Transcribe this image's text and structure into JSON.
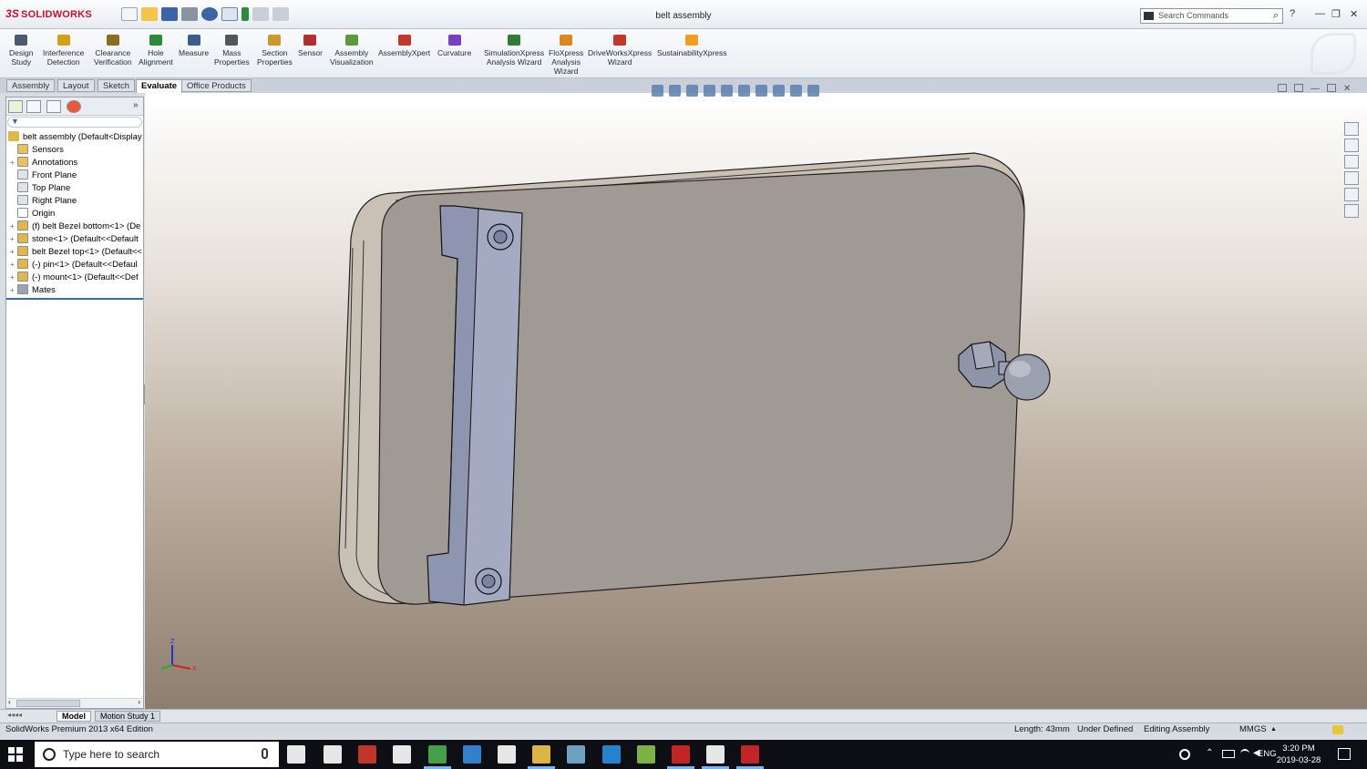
{
  "titlebar": {
    "brand_ds": "3S",
    "brand_name": "SOLIDWORKS",
    "document_title": "belt assembly",
    "search_placeholder": "Search Commands",
    "help_icon": "?",
    "minimize": "—",
    "restore": "❐",
    "close": "✕"
  },
  "ribbon": {
    "buttons": [
      {
        "label": "Design\nStudy",
        "icon": "design-study-icon",
        "color": "#4a5a70"
      },
      {
        "label": "Interference\nDetection",
        "icon": "interference-icon",
        "color": "#d4a017"
      },
      {
        "label": "Clearance\nVerification",
        "icon": "clearance-icon",
        "color": "#8a6d1e"
      },
      {
        "label": "Hole\nAlignment",
        "icon": "hole-alignment-icon",
        "color": "#2d8a3a"
      },
      {
        "label": "Measure",
        "icon": "measure-icon",
        "color": "#3a5d8c"
      },
      {
        "label": "Mass\nProperties",
        "icon": "mass-properties-icon",
        "color": "#555"
      },
      {
        "label": "Section\nProperties",
        "icon": "section-properties-icon",
        "color": "#c99a2e"
      },
      {
        "label": "Sensor",
        "icon": "sensor-icon",
        "color": "#b03030"
      },
      {
        "label": "Assembly\nVisualization",
        "icon": "assembly-visualization-icon",
        "color": "#5a9a3a"
      },
      {
        "label": "AssemblyXpert",
        "icon": "assemblyxpert-icon",
        "color": "#c0392b"
      },
      {
        "label": "Curvature",
        "icon": "curvature-icon",
        "color": "#7a3fc0"
      },
      {
        "label": "SimulationXpress\nAnalysis Wizard",
        "icon": "simulationxpress-icon",
        "color": "#2e7d32"
      },
      {
        "label": "FloXpress\nAnalysis\nWizard",
        "icon": "floxpress-icon",
        "color": "#d98a1e"
      },
      {
        "label": "DriveWorksXpress\nWizard",
        "icon": "driveworksxpress-icon",
        "color": "#c0392b"
      },
      {
        "label": "SustainabilityXpress",
        "icon": "sustainabilityxpress-icon",
        "color": "#f0a020"
      }
    ]
  },
  "tabs": [
    {
      "label": "Assembly",
      "active": false
    },
    {
      "label": "Layout",
      "active": false
    },
    {
      "label": "Sketch",
      "active": false
    },
    {
      "label": "Evaluate",
      "active": true
    },
    {
      "label": "Office Products",
      "active": false
    }
  ],
  "tree": {
    "root": "belt assembly  (Default<Display",
    "items": [
      {
        "label": "Sensors",
        "expander": "",
        "icon": "sensors-folder-icon",
        "color": "#e8c15a"
      },
      {
        "label": "Annotations",
        "expander": "+",
        "icon": "annotations-icon",
        "color": "#e8c15a"
      },
      {
        "label": "Front Plane",
        "expander": "",
        "icon": "plane-icon",
        "color": "#dfe3e8"
      },
      {
        "label": "Top Plane",
        "expander": "",
        "icon": "plane-icon",
        "color": "#dfe3e8"
      },
      {
        "label": "Right Plane",
        "expander": "",
        "icon": "plane-icon",
        "color": "#dfe3e8"
      },
      {
        "label": "Origin",
        "expander": "",
        "icon": "origin-icon",
        "color": "#ffffff"
      },
      {
        "label": "(f) belt Bezel bottom<1> (De",
        "expander": "+",
        "icon": "part-icon",
        "color": "#e0b84a"
      },
      {
        "label": "stone<1> (Default<<Default",
        "expander": "+",
        "icon": "part-icon",
        "color": "#e0b84a"
      },
      {
        "label": "belt Bezel top<1> (Default<<",
        "expander": "+",
        "icon": "part-icon",
        "color": "#e0b84a"
      },
      {
        "label": "(-) pin<1> (Default<<Defaul",
        "expander": "+",
        "icon": "part-icon",
        "color": "#e0b84a"
      },
      {
        "label": "(-) mount<1> (Default<<Def",
        "expander": "+",
        "icon": "part-icon",
        "color": "#e0b84a"
      },
      {
        "label": "Mates",
        "expander": "+",
        "icon": "mates-icon",
        "color": "#9aa4b0"
      }
    ]
  },
  "viewport": {
    "triad": {
      "z": "Z",
      "y": "Y",
      "x": "X"
    }
  },
  "model_tabs": [
    {
      "label": "Model",
      "active": true
    },
    {
      "label": "Motion Study 1",
      "active": false
    }
  ],
  "status": {
    "edition": "SolidWorks Premium 2013 x64 Edition",
    "length": "Length: 43mm",
    "definition": "Under Defined",
    "mode": "Editing Assembly",
    "units": "MMGS",
    "units_arrow": "▲"
  },
  "taskbar": {
    "search_placeholder": "Type here to search",
    "language": "ENG",
    "time": "3:20 PM",
    "date": "2019-03-28",
    "apps": [
      {
        "name": "task-view-icon",
        "color": "#ffffff"
      },
      {
        "name": "store-icon",
        "color": "#ffffff"
      },
      {
        "name": "app-red-icon",
        "color": "#d23b2a"
      },
      {
        "name": "mail-icon",
        "color": "#ffffff"
      },
      {
        "name": "chrome-icon",
        "color": "#4caf50"
      },
      {
        "name": "app-blue-icon",
        "color": "#3a8dde"
      },
      {
        "name": "calculator-icon",
        "color": "#ffffff"
      },
      {
        "name": "file-explorer-icon",
        "color": "#f2c94c"
      },
      {
        "name": "app-globe-icon",
        "color": "#7ab0d6"
      },
      {
        "name": "edge-icon",
        "color": "#2a8fe0"
      },
      {
        "name": "eclipse-2019-icon",
        "color": "#8bc34a"
      },
      {
        "name": "solidworks-icon",
        "color": "#d62828"
      },
      {
        "name": "xming-icon",
        "color": "#ffffff"
      },
      {
        "name": "solidworks-active-icon",
        "color": "#d62828"
      }
    ]
  }
}
